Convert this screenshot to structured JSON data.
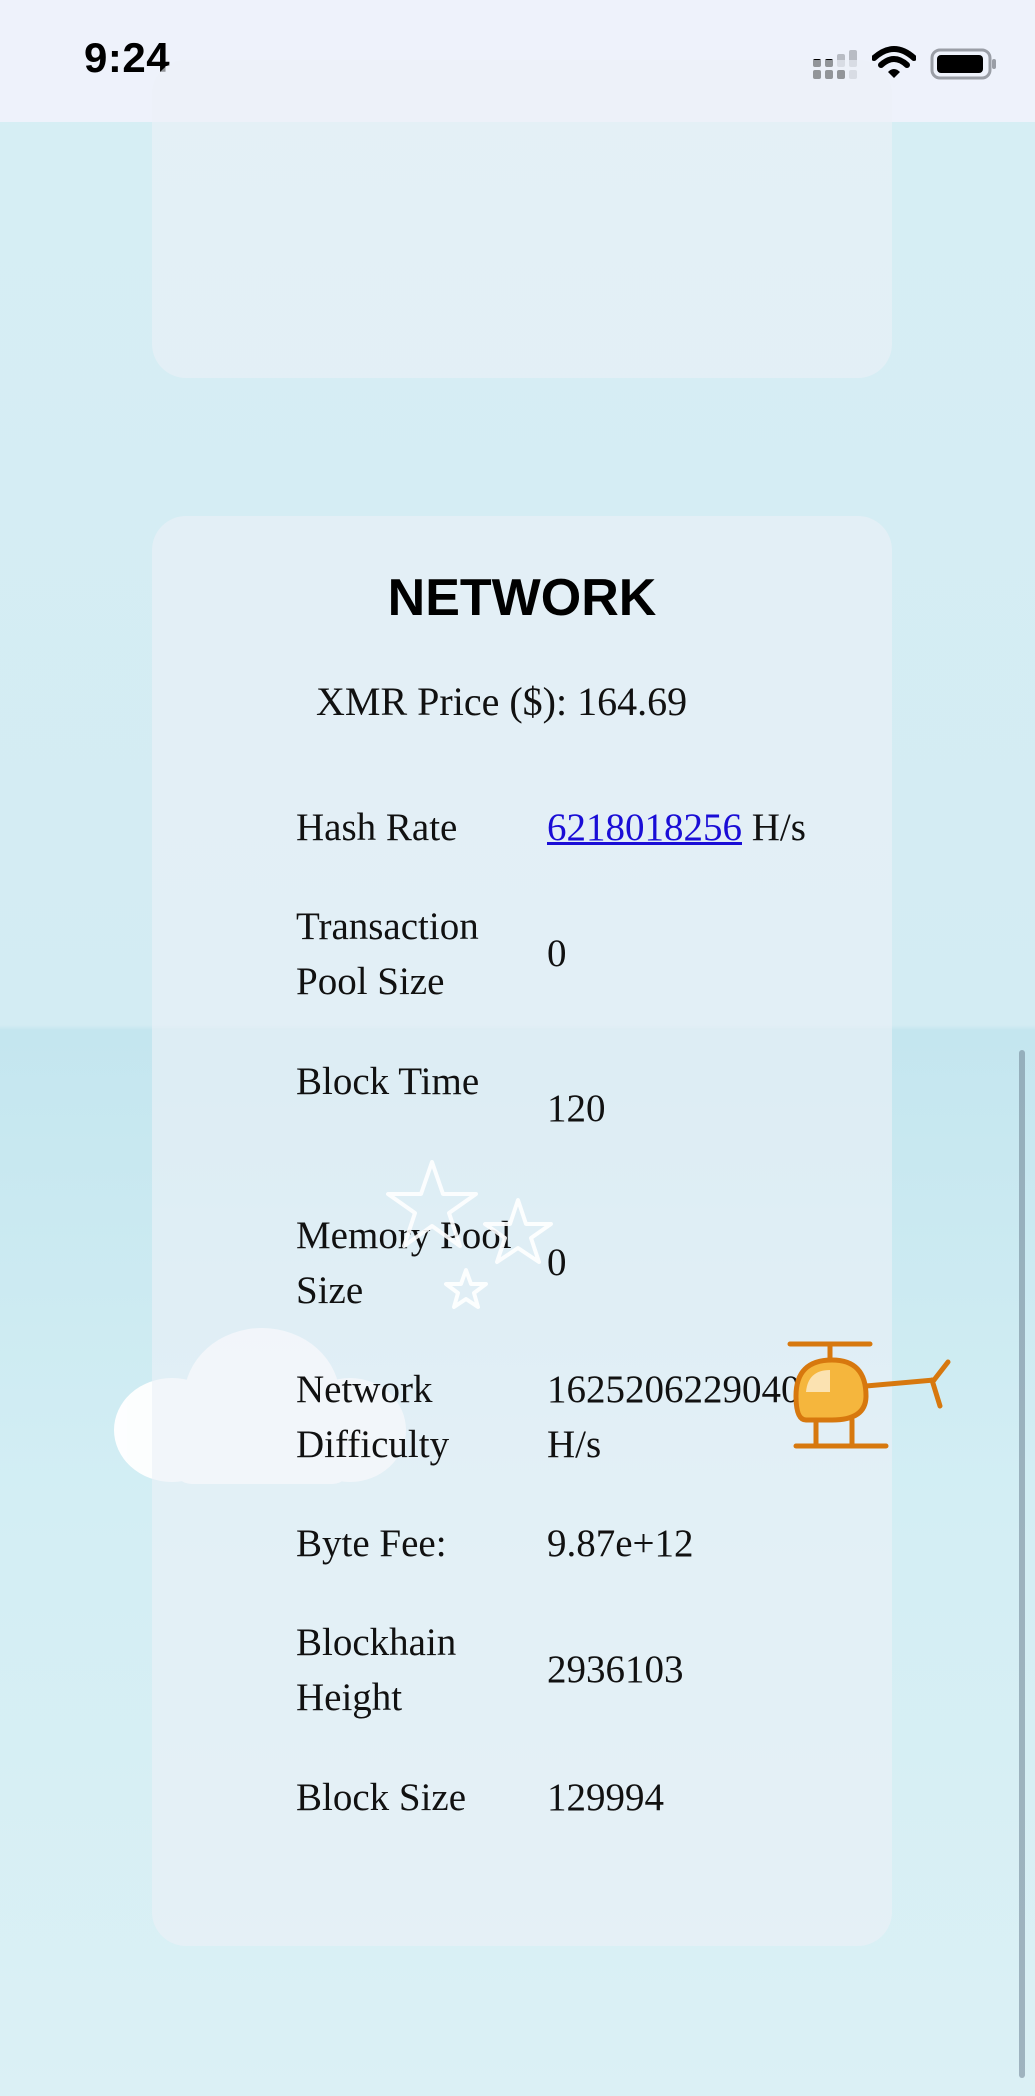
{
  "status_bar": {
    "time": "9:24"
  },
  "network": {
    "title": "NETWORK",
    "price": "XMR Price ($): 164.69",
    "hash_rate": {
      "label": "Hash Rate",
      "value": "6218018256",
      "unit": " H/s"
    },
    "tx_pool": {
      "label": "Transaction Pool Size",
      "value": "0"
    },
    "block_time": {
      "label": "Block Time",
      "value": "120"
    },
    "memory_pool": {
      "label": "Memory Pool Size",
      "value": "0"
    },
    "difficulty": {
      "label": "Network Difficulty",
      "value": "1625206229040101",
      "unit": "H/s"
    },
    "byte_fee": {
      "label": "Byte Fee:",
      "value": "9.87e+12"
    },
    "height": {
      "label": "Blockhain Height",
      "value": "2936103"
    },
    "block_size": {
      "label": "Block Size",
      "value": "129994"
    }
  },
  "icons": {
    "signal": "cellular-signal-icon",
    "wifi": "wifi-icon",
    "battery": "battery-icon",
    "stars": "stars-icon",
    "cloud": "cloud-icon",
    "helicopter": "helicopter-icon"
  },
  "colors": {
    "link": "#1a0dd6",
    "background": "#d7eef4",
    "status_bar": "#eef2fb"
  }
}
